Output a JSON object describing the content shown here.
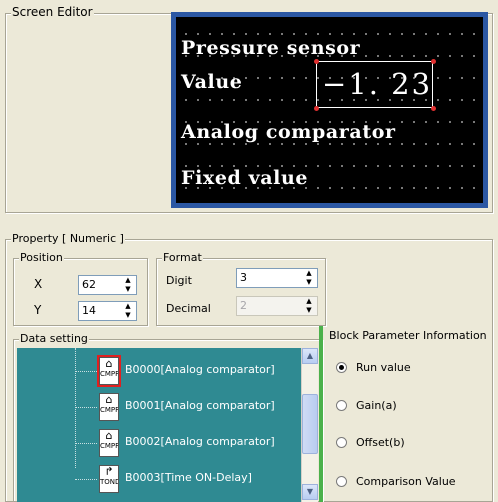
{
  "screen_editor": {
    "title": "Screen Editor",
    "lcd_lines": [
      "Pressure sensor",
      "Value",
      "Analog comparator",
      "Fixed value"
    ],
    "value_display": "−1. 23"
  },
  "property": {
    "title": "Property [ Numeric ]",
    "position": {
      "title": "Position",
      "x_label": "X",
      "x_value": "62",
      "y_label": "Y",
      "y_value": "14"
    },
    "format": {
      "title": "Format",
      "digit_label": "Digit",
      "digit_value": "3",
      "decimal_label": "Decimal",
      "decimal_value": "2"
    }
  },
  "data_setting": {
    "title": "Data setting",
    "items": [
      {
        "label": "B0000[Analog comparator]",
        "icon": "analog-comparator-icon",
        "icon_text": "CMPR",
        "selected": true
      },
      {
        "label": "B0001[Analog comparator]",
        "icon": "analog-comparator-icon",
        "icon_text": "CMPR",
        "selected": false
      },
      {
        "label": "B0002[Analog comparator]",
        "icon": "analog-comparator-icon",
        "icon_text": "CMPR",
        "selected": false
      },
      {
        "label": "B0003[Time ON-Delay]",
        "icon": "timer-on-delay-icon",
        "icon_text": "TOND",
        "selected": false
      }
    ]
  },
  "block_params": {
    "title": "Block Parameter Information",
    "options": [
      "Run value",
      "Gain(a)",
      "Offset(b)",
      "Comparison Value"
    ],
    "selected_index": 0
  },
  "colors": {
    "window_bg": "#ece9d8",
    "lcd_frame": "#2b57a3",
    "tree_bg": "#2f8a92",
    "accent_bar": "#4bb14b"
  }
}
